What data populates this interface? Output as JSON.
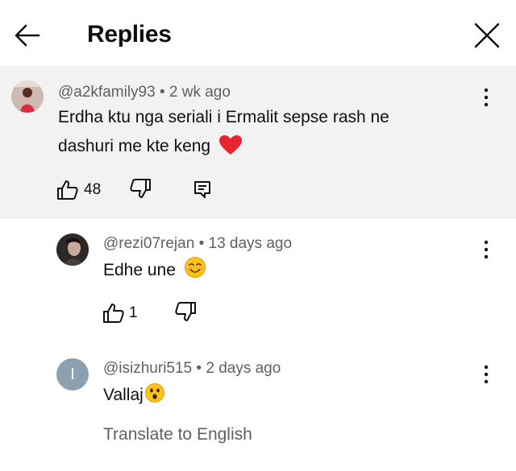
{
  "header": {
    "title": "Replies"
  },
  "parent_comment": {
    "handle": "@a2kfamily93",
    "age": "2 wk ago",
    "text_line1": "Erdha ktu nga seriali i Ermalit sepse rash ne",
    "text_line2": "dashuri me kte keng",
    "likes": "48"
  },
  "replies": [
    {
      "handle": "@rezi07rejan",
      "age": "13 days ago",
      "text": "Edhe une",
      "likes": "1"
    },
    {
      "handle": "@isizhuri515",
      "age": "2 days ago",
      "text": "Vallaj",
      "avatar_letter": "I",
      "avatar_color": "#8ca0b1"
    }
  ],
  "translate_label": "Translate to English",
  "colors": {
    "background": "#ffffff",
    "parent_bg": "#f2f2f2",
    "meta": "#606060",
    "heart": "#e8222f"
  }
}
